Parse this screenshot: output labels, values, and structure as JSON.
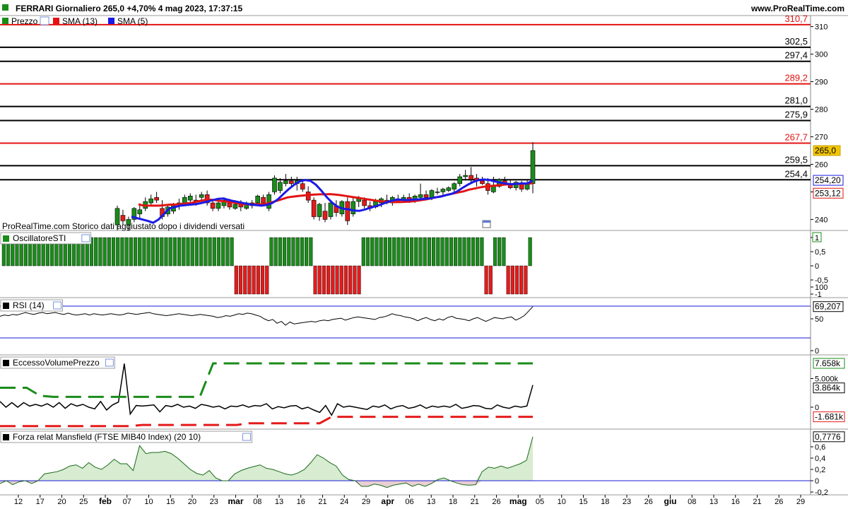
{
  "header": {
    "title": "FERRARI Giornaliero 265,0 +4,70% 4 mag 2023, 17:37:15",
    "site": "www.ProRealTime.com"
  },
  "colors": {
    "up": "#1a8c1a",
    "down": "#e41b1b",
    "sma13": "#e31313",
    "sma5": "#1a1ae6",
    "red_level": "#e31313",
    "black_level": "#000000",
    "last_price_bg": "#f2c500",
    "area_pos": "#d7ecd0",
    "area_neg": "#e8cfd4"
  },
  "price_panel": {
    "legend": [
      {
        "label": "Prezzo",
        "color": "#1a8c1a"
      },
      {
        "label": "SMA (13)",
        "color": "#e31313"
      },
      {
        "label": "SMA (5)",
        "color": "#1a1ae6"
      }
    ],
    "levels": [
      {
        "value": 310.7,
        "label": "310,7",
        "color": "#e31313"
      },
      {
        "value": 302.5,
        "label": "302,5",
        "color": "#000000"
      },
      {
        "value": 297.4,
        "label": "297,4",
        "color": "#000000"
      },
      {
        "value": 289.2,
        "label": "289,2",
        "color": "#e31313"
      },
      {
        "value": 281.0,
        "label": "281,0",
        "color": "#000000"
      },
      {
        "value": 275.9,
        "label": "275,9",
        "color": "#000000"
      },
      {
        "value": 267.7,
        "label": "267,7",
        "color": "#e31313"
      },
      {
        "value": 259.5,
        "label": "259,5",
        "color": "#000000"
      },
      {
        "value": 254.4,
        "label": "254,4",
        "color": "#000000"
      }
    ],
    "y_ticks": [
      "310",
      "300",
      "290",
      "280",
      "270",
      "260",
      "250",
      "240"
    ],
    "last_price_label": "265,0",
    "sma5_label": "254,20",
    "sma13_label": "253,12",
    "watermark": "ProRealTime.com  Storico dati aggiustato dopo i dividendi versati"
  },
  "oscillatore_panel": {
    "title": "OscillatoreSTI",
    "y_ticks": [
      "1",
      "0,5",
      "0",
      "-0,5",
      "-1"
    ]
  },
  "rsi_panel": {
    "title": "RSI (14)",
    "y_ticks": [
      "100",
      "50",
      "0"
    ],
    "value_label": "69,207"
  },
  "ecv_panel": {
    "title": "EccessoVolumePrezzo",
    "y_ticks": [
      "5.000k",
      "0"
    ],
    "upper_label": "7.658k",
    "value_label": "3.864k",
    "lower_label": "-1.681k"
  },
  "mansfield_panel": {
    "title": "Forza relat Mansfield (FTSE MIB40 Index) (20 10)",
    "y_ticks": [
      "0,6",
      "0,4",
      "0,2",
      "0",
      "-0,2"
    ],
    "value_label": "0,7776"
  },
  "x_axis": {
    "labels": [
      {
        "text": "12",
        "bold": false
      },
      {
        "text": "17",
        "bold": false
      },
      {
        "text": "20",
        "bold": false
      },
      {
        "text": "25",
        "bold": false
      },
      {
        "text": "feb",
        "bold": true
      },
      {
        "text": "07",
        "bold": false
      },
      {
        "text": "10",
        "bold": false
      },
      {
        "text": "15",
        "bold": false
      },
      {
        "text": "20",
        "bold": false
      },
      {
        "text": "23",
        "bold": false
      },
      {
        "text": "mar",
        "bold": true
      },
      {
        "text": "08",
        "bold": false
      },
      {
        "text": "13",
        "bold": false
      },
      {
        "text": "16",
        "bold": false
      },
      {
        "text": "21",
        "bold": false
      },
      {
        "text": "24",
        "bold": false
      },
      {
        "text": "29",
        "bold": false
      },
      {
        "text": "apr",
        "bold": true
      },
      {
        "text": "06",
        "bold": false
      },
      {
        "text": "13",
        "bold": false
      },
      {
        "text": "18",
        "bold": false
      },
      {
        "text": "21",
        "bold": false
      },
      {
        "text": "26",
        "bold": false
      },
      {
        "text": "mag",
        "bold": true
      },
      {
        "text": "05",
        "bold": false
      },
      {
        "text": "10",
        "bold": false
      },
      {
        "text": "15",
        "bold": false
      },
      {
        "text": "18",
        "bold": false
      },
      {
        "text": "23",
        "bold": false
      },
      {
        "text": "26",
        "bold": false
      },
      {
        "text": "giu",
        "bold": true
      },
      {
        "text": "08",
        "bold": false
      },
      {
        "text": "13",
        "bold": false
      },
      {
        "text": "16",
        "bold": false
      },
      {
        "text": "21",
        "bold": false
      },
      {
        "text": "26",
        "bold": false
      },
      {
        "text": "29",
        "bold": false
      }
    ]
  },
  "chart_data": {
    "type": "candlestick",
    "title": "FERRARI Giornaliero",
    "ylim": [
      236,
      314
    ],
    "candles": [
      {
        "o": 238.0,
        "h": 245.0,
        "l": 236.0,
        "c": 244.0
      },
      {
        "o": 241.5,
        "h": 243.5,
        "l": 238.0,
        "c": 239.5
      },
      {
        "o": 238.0,
        "h": 241.0,
        "l": 236.0,
        "c": 240.0
      },
      {
        "o": 240.0,
        "h": 244.5,
        "l": 239.0,
        "c": 244.0
      },
      {
        "o": 242.0,
        "h": 245.5,
        "l": 240.5,
        "c": 243.5
      },
      {
        "o": 244.0,
        "h": 248.0,
        "l": 243.0,
        "c": 246.5
      },
      {
        "o": 246.0,
        "h": 249.0,
        "l": 245.0,
        "c": 247.5
      },
      {
        "o": 248.0,
        "h": 250.0,
        "l": 246.0,
        "c": 247.0
      },
      {
        "o": 244.0,
        "h": 247.0,
        "l": 240.0,
        "c": 241.0
      },
      {
        "o": 242.0,
        "h": 245.0,
        "l": 241.0,
        "c": 244.5
      },
      {
        "o": 243.0,
        "h": 246.0,
        "l": 242.0,
        "c": 245.0
      },
      {
        "o": 245.0,
        "h": 247.5,
        "l": 243.5,
        "c": 246.0
      },
      {
        "o": 246.0,
        "h": 249.0,
        "l": 245.0,
        "c": 248.0
      },
      {
        "o": 247.0,
        "h": 249.5,
        "l": 246.0,
        "c": 248.5
      },
      {
        "o": 247.0,
        "h": 249.0,
        "l": 245.0,
        "c": 246.5
      },
      {
        "o": 248.0,
        "h": 250.0,
        "l": 246.0,
        "c": 249.0
      },
      {
        "o": 249.0,
        "h": 250.5,
        "l": 245.0,
        "c": 246.0
      },
      {
        "o": 246.0,
        "h": 247.0,
        "l": 243.0,
        "c": 244.0
      },
      {
        "o": 244.0,
        "h": 247.0,
        "l": 243.0,
        "c": 246.0
      },
      {
        "o": 245.0,
        "h": 248.0,
        "l": 244.0,
        "c": 247.0
      },
      {
        "o": 246.0,
        "h": 247.5,
        "l": 243.5,
        "c": 244.5
      },
      {
        "o": 244.0,
        "h": 247.0,
        "l": 243.5,
        "c": 245.5
      },
      {
        "o": 245.5,
        "h": 247.0,
        "l": 243.0,
        "c": 244.5
      },
      {
        "o": 244.0,
        "h": 246.5,
        "l": 243.5,
        "c": 246.0
      },
      {
        "o": 245.0,
        "h": 247.0,
        "l": 244.0,
        "c": 246.0
      },
      {
        "o": 246.0,
        "h": 249.0,
        "l": 245.0,
        "c": 248.5
      },
      {
        "o": 248.0,
        "h": 249.0,
        "l": 245.0,
        "c": 246.0
      },
      {
        "o": 244.0,
        "h": 250.0,
        "l": 243.0,
        "c": 249.0
      },
      {
        "o": 250.0,
        "h": 256.0,
        "l": 249.0,
        "c": 255.0
      },
      {
        "o": 250.5,
        "h": 255.0,
        "l": 249.5,
        "c": 253.5
      },
      {
        "o": 253.0,
        "h": 256.5,
        "l": 252.0,
        "c": 254.0
      },
      {
        "o": 254.0,
        "h": 255.5,
        "l": 252.0,
        "c": 253.0
      },
      {
        "o": 253.0,
        "h": 255.5,
        "l": 250.5,
        "c": 254.0
      },
      {
        "o": 253.0,
        "h": 254.0,
        "l": 250.0,
        "c": 251.0
      },
      {
        "o": 250.0,
        "h": 252.0,
        "l": 246.0,
        "c": 247.0
      },
      {
        "o": 247.0,
        "h": 248.0,
        "l": 240.0,
        "c": 241.0
      },
      {
        "o": 241.0,
        "h": 246.0,
        "l": 239.5,
        "c": 245.5
      },
      {
        "o": 243.0,
        "h": 246.0,
        "l": 239.0,
        "c": 240.0
      },
      {
        "o": 241.0,
        "h": 246.5,
        "l": 240.0,
        "c": 246.0
      },
      {
        "o": 245.0,
        "h": 247.0,
        "l": 241.0,
        "c": 242.5
      },
      {
        "o": 242.0,
        "h": 247.0,
        "l": 241.0,
        "c": 246.5
      },
      {
        "o": 246.5,
        "h": 248.0,
        "l": 238.0,
        "c": 239.5
      },
      {
        "o": 242.0,
        "h": 248.0,
        "l": 241.0,
        "c": 246.5
      },
      {
        "o": 246.5,
        "h": 248.5,
        "l": 244.5,
        "c": 247.5
      },
      {
        "o": 247.0,
        "h": 248.0,
        "l": 244.0,
        "c": 245.0
      },
      {
        "o": 245.0,
        "h": 246.5,
        "l": 243.0,
        "c": 244.0
      },
      {
        "o": 244.5,
        "h": 247.5,
        "l": 244.0,
        "c": 246.5
      },
      {
        "o": 246.0,
        "h": 248.0,
        "l": 244.5,
        "c": 247.5
      },
      {
        "o": 247.0,
        "h": 249.0,
        "l": 245.5,
        "c": 246.0
      },
      {
        "o": 246.0,
        "h": 248.5,
        "l": 245.0,
        "c": 248.0
      },
      {
        "o": 247.5,
        "h": 249.0,
        "l": 246.5,
        "c": 246.5
      },
      {
        "o": 247.0,
        "h": 249.0,
        "l": 246.0,
        "c": 248.0
      },
      {
        "o": 248.0,
        "h": 249.5,
        "l": 246.0,
        "c": 246.5
      },
      {
        "o": 246.5,
        "h": 249.0,
        "l": 246.0,
        "c": 248.5
      },
      {
        "o": 248.0,
        "h": 253.0,
        "l": 247.0,
        "c": 249.0
      },
      {
        "o": 249.0,
        "h": 250.5,
        "l": 247.0,
        "c": 248.0
      },
      {
        "o": 248.0,
        "h": 251.0,
        "l": 247.0,
        "c": 250.5
      },
      {
        "o": 250.0,
        "h": 251.5,
        "l": 249.0,
        "c": 250.0
      },
      {
        "o": 250.0,
        "h": 251.5,
        "l": 248.5,
        "c": 251.0
      },
      {
        "o": 250.5,
        "h": 252.0,
        "l": 250.0,
        "c": 251.5
      },
      {
        "o": 251.0,
        "h": 253.5,
        "l": 250.0,
        "c": 253.0
      },
      {
        "o": 253.0,
        "h": 256.5,
        "l": 252.0,
        "c": 255.5
      },
      {
        "o": 255.5,
        "h": 258.0,
        "l": 254.5,
        "c": 256.0
      },
      {
        "o": 256.0,
        "h": 259.0,
        "l": 253.0,
        "c": 254.5
      },
      {
        "o": 255.0,
        "h": 256.5,
        "l": 252.0,
        "c": 254.0
      },
      {
        "o": 254.0,
        "h": 255.5,
        "l": 252.5,
        "c": 253.0
      },
      {
        "o": 253.0,
        "h": 255.0,
        "l": 249.0,
        "c": 250.5
      },
      {
        "o": 250.0,
        "h": 255.5,
        "l": 249.5,
        "c": 252.5
      },
      {
        "o": 252.0,
        "h": 255.0,
        "l": 251.5,
        "c": 254.5
      },
      {
        "o": 254.0,
        "h": 255.5,
        "l": 252.5,
        "c": 253.0
      },
      {
        "o": 253.0,
        "h": 254.5,
        "l": 251.0,
        "c": 251.5
      },
      {
        "o": 251.5,
        "h": 254.0,
        "l": 250.5,
        "c": 253.5
      },
      {
        "o": 253.0,
        "h": 254.0,
        "l": 250.0,
        "c": 251.0
      },
      {
        "o": 251.0,
        "h": 254.5,
        "l": 250.5,
        "c": 253.0
      },
      {
        "o": 253.0,
        "h": 268.0,
        "l": 249.5,
        "c": 265.0
      }
    ],
    "sma13": [
      245.5,
      245.0,
      245.0,
      245.0,
      245.0,
      245.2,
      245.4,
      245.4,
      245.6,
      245.8,
      246.0,
      246.5,
      246.9,
      247.2,
      247.1,
      246.8,
      246.6,
      246.4,
      246.1,
      245.8,
      245.5,
      245.5,
      245.5,
      245.5,
      245.7,
      246.2,
      246.8,
      247.4,
      248.0,
      248.3,
      248.5,
      248.7,
      248.9,
      249.0,
      249.1,
      249.1,
      249.2,
      249.0,
      248.8,
      248.5,
      248.2,
      247.9,
      247.6,
      247.3,
      247.0,
      246.7,
      246.5,
      246.4,
      246.3,
      246.3,
      246.4,
      246.5,
      246.7,
      247.0,
      247.3,
      247.7,
      248.1,
      248.5,
      249.0,
      249.4,
      249.8,
      250.2,
      250.8,
      251.2,
      251.6,
      251.9,
      252.1,
      252.3,
      252.5,
      252.7,
      252.8,
      252.9,
      252.9,
      253.0,
      253.12
    ],
    "sma5": [
      241.0,
      240.5,
      240.0,
      239.5,
      238.8,
      240.0,
      242.0,
      244.0,
      244.5,
      245.0,
      245.2,
      245.4,
      245.6,
      246.0,
      246.5,
      247.0,
      247.5,
      247.6,
      247.0,
      246.6,
      246.2,
      245.8,
      245.4,
      245.2,
      245.0,
      245.3,
      246.0,
      247.3,
      249.2,
      251.0,
      252.6,
      253.8,
      254.3,
      254.0,
      252.6,
      250.5,
      248.1,
      246.1,
      244.6,
      243.9,
      243.7,
      243.2,
      243.1,
      243.6,
      244.2,
      244.8,
      245.4,
      246.2,
      246.8,
      247.2,
      247.1,
      247.0,
      247.2,
      247.3,
      247.5,
      247.6,
      248.0,
      248.3,
      248.8,
      249.3,
      250.1,
      251.4,
      252.6,
      253.6,
      254.3,
      254.5,
      254.3,
      253.8,
      253.4,
      253.0,
      252.8,
      252.9,
      253.1,
      253.0,
      254.2
    ],
    "oscillatore": [
      1,
      1,
      1,
      1,
      1,
      1,
      1,
      1,
      1,
      1,
      1,
      1,
      1,
      1,
      1,
      1,
      1,
      1,
      1,
      1,
      1,
      1,
      1,
      1,
      1,
      1,
      1,
      1,
      1,
      1,
      1,
      1,
      1,
      1,
      1,
      1,
      1,
      1,
      1,
      1,
      1,
      1,
      1,
      1,
      1,
      1,
      1,
      1,
      1,
      1,
      1,
      1,
      1,
      -1,
      -1,
      -1,
      -1,
      -1,
      -1,
      -1,
      -1,
      1,
      1,
      1,
      1,
      1,
      1,
      1,
      1,
      1,
      1,
      -1,
      -1,
      -1,
      -1,
      -1,
      -1,
      -1,
      -1,
      -1,
      -1,
      -1,
      1,
      1,
      1,
      1,
      1,
      1,
      1,
      1,
      1,
      1,
      1,
      1,
      1,
      1,
      1,
      1,
      1,
      1,
      1,
      1,
      1,
      1,
      1,
      1,
      1,
      1,
      1,
      1,
      -1,
      -1,
      1,
      1,
      1,
      -1,
      -1,
      -1,
      -1,
      -1,
      1
    ],
    "rsi": [
      54,
      56,
      55,
      57,
      56,
      58,
      60,
      58,
      57,
      59,
      60,
      58,
      59,
      60,
      58,
      57,
      59,
      57,
      56,
      57,
      58,
      56,
      58,
      57,
      56,
      57,
      58,
      57,
      56,
      57,
      59,
      58,
      57,
      58,
      59,
      60,
      58,
      57,
      56,
      55,
      56,
      57,
      58,
      57,
      56,
      55,
      56,
      57,
      56,
      55,
      54,
      52,
      53,
      55,
      54,
      56,
      58,
      57,
      59,
      58,
      56,
      54,
      50,
      47,
      49,
      43,
      46,
      40,
      45,
      42,
      43,
      44,
      45,
      46,
      45,
      47,
      48,
      47,
      49,
      50,
      51,
      48,
      50,
      52,
      53,
      52,
      51,
      50,
      49,
      52,
      53,
      55,
      58,
      56,
      55,
      53,
      52,
      50,
      47,
      50,
      52,
      49,
      47,
      50,
      48,
      52,
      54,
      51,
      50,
      49,
      47,
      50,
      52,
      49,
      46,
      49,
      52,
      51,
      50,
      52,
      53,
      48,
      51,
      55,
      62,
      69.207
    ],
    "ecv": [
      1.0,
      0.0,
      0.8,
      0.0,
      0.8,
      0.2,
      0.5,
      0.2,
      0.6,
      0.0,
      0.8,
      -0.2,
      0.6,
      0.2,
      0.5,
      0.0,
      -0.3,
      1.0,
      -0.5,
      0.4,
      0.9,
      7.6,
      -1.2,
      0.3,
      0.2,
      0.3,
      0.4,
      -0.8,
      0.3,
      0.1,
      0.5,
      0.0,
      0.2,
      -0.2,
      0.5,
      0.3,
      0.0,
      0.2,
      -0.3,
      0.2,
      0.1,
      0.4,
      0.0,
      0.3,
      0.2,
      0.6,
      -0.3,
      0.1,
      -0.1,
      0.2,
      0.3,
      -0.3,
      0.0,
      -0.5,
      -0.9,
      0.3,
      -1.4,
      0.6,
      0.0,
      0.2,
      0.0,
      -0.2,
      -0.4,
      0.2,
      0.0,
      0.4,
      -0.3,
      0.1,
      0.3,
      -0.2,
      0.0,
      0.4,
      -0.2,
      0.2,
      0.0,
      0.2,
      0.0,
      0.5,
      -0.2,
      0.0,
      0.3,
      0.2,
      -0.2,
      -0.3,
      0.4,
      0.0,
      -0.2,
      0.2,
      0.0,
      0.2,
      3.864
    ],
    "ecv_upper": [
      3.4,
      3.4,
      3.4,
      2.0,
      1.8,
      1.8,
      1.8,
      1.8,
      1.8,
      1.8,
      1.8,
      1.8,
      1.8,
      1.8,
      1.8,
      1.8,
      7.658,
      7.658,
      7.658,
      7.658,
      7.658,
      7.658,
      7.658,
      7.658,
      7.658,
      7.658,
      7.658,
      7.658,
      7.658,
      7.658,
      7.658,
      7.658,
      7.658,
      7.658,
      7.658,
      7.658,
      7.658,
      7.658,
      7.658,
      7.658,
      7.658
    ],
    "ecv_lower": [
      -3.3,
      -3.3,
      -3.3,
      -3.3,
      -3.3,
      -3.3,
      -3.3,
      -3.3,
      -3.3,
      -3.3,
      -3.3,
      -3.3,
      -3.1,
      -3.1,
      -3.1,
      -3.1,
      -3.1,
      -3.1,
      -3.1,
      -3.1,
      -3.1,
      -2.8,
      -2.8,
      -2.8,
      -2.8,
      -2.8,
      -2.8,
      -2.8,
      -1.681,
      -1.681,
      -1.681,
      -1.681,
      -1.681,
      -1.681,
      -1.681,
      -1.681,
      -1.681,
      -1.681,
      -1.681,
      -1.681,
      -1.681,
      -1.681,
      -1.681,
      -1.681,
      -1.681,
      -1.681
    ],
    "mansfield": [
      -0.05,
      0.0,
      -0.07,
      -0.02,
      0.0,
      -0.05,
      0.0,
      0.12,
      0.14,
      0.16,
      0.2,
      0.26,
      0.28,
      0.22,
      0.32,
      0.24,
      0.2,
      0.28,
      0.38,
      0.3,
      0.3,
      0.18,
      0.62,
      0.48,
      0.5,
      0.5,
      0.52,
      0.48,
      0.4,
      0.3,
      0.2,
      0.13,
      0.1,
      0.18,
      0.05,
      0.0,
      0.0,
      0.12,
      0.18,
      0.22,
      0.25,
      0.28,
      0.22,
      0.2,
      0.16,
      0.12,
      0.1,
      0.14,
      0.2,
      0.32,
      0.46,
      0.4,
      0.32,
      0.26,
      0.1,
      0.02,
      0.0,
      -0.1,
      -0.1,
      -0.06,
      -0.08,
      -0.12,
      -0.08,
      -0.06,
      -0.04,
      -0.1,
      -0.06,
      -0.1,
      -0.05,
      0.02,
      0.05,
      0.0,
      -0.04,
      -0.07,
      -0.08,
      -0.07,
      0.16,
      0.24,
      0.22,
      0.26,
      0.22,
      0.26,
      0.3,
      0.36,
      0.7776
    ]
  }
}
